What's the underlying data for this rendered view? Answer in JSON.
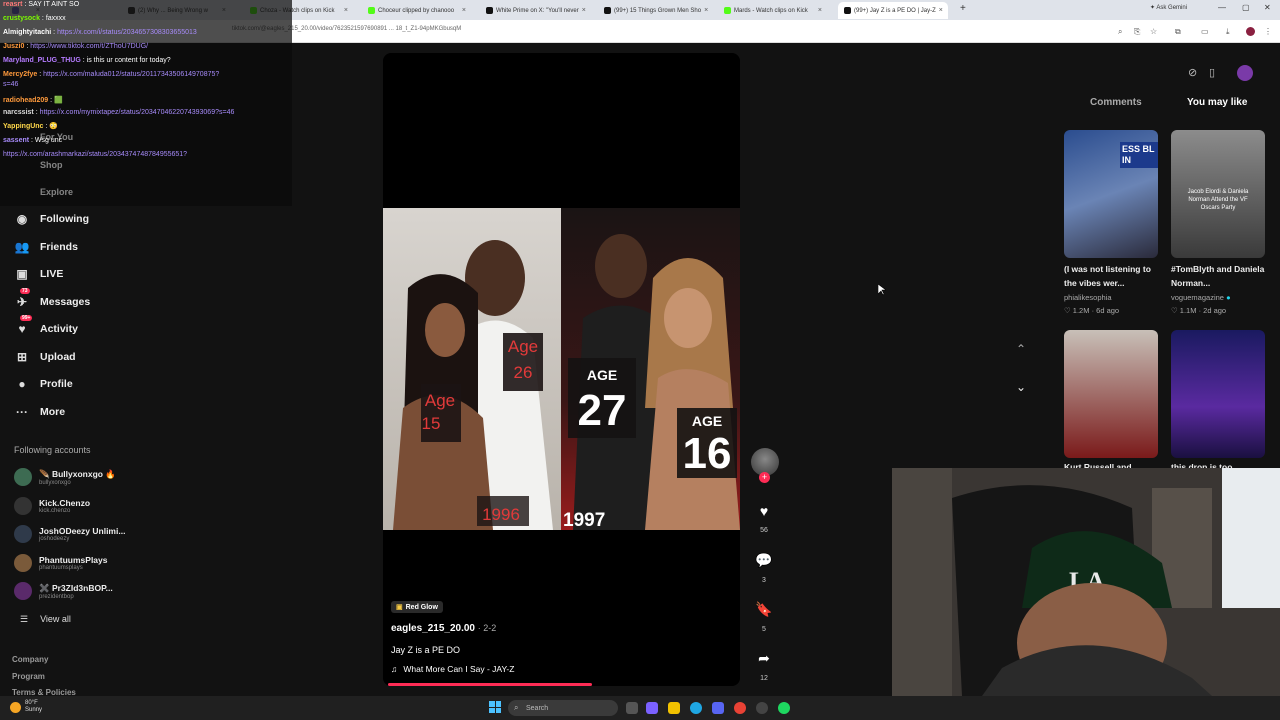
{
  "browser": {
    "tabs": [
      {
        "label": "",
        "color": "#6e6ec9"
      },
      {
        "label": "(2) Why ... Being Wrong w",
        "color": "#333"
      },
      {
        "label": "Choza - Watch clips on Kick",
        "color": "#53fc18"
      },
      {
        "label": "Choceur clipped by chanooo",
        "color": "#53fc18"
      },
      {
        "label": "White Prime on X: \"You'll never",
        "color": "#111"
      },
      {
        "label": "(99+) 15 Things Grown Men Sho",
        "color": "#111"
      },
      {
        "label": "Mards - Watch clips on Kick",
        "color": "#53fc18"
      },
      {
        "label": "(99+) Jay Z is a PE DO | Jay-Z",
        "color": "#111"
      }
    ],
    "new_tab": "+",
    "ask_gemini": "✦ Ask Gemini",
    "window_controls": [
      "—",
      "▢",
      "✕"
    ],
    "url": "tiktok.com/@eagles_215_20.00/video/7623521597690891 ... 18_t_Z1-94pMKGbusqM"
  },
  "chat": {
    "messages": [
      {
        "user": "reasrt",
        "text": "SAY IT AINT SO",
        "color": "#ff7a7a",
        "link": false
      },
      {
        "user": "crustysock",
        "text": "faxxxx",
        "color": "#7cfc00",
        "link": false
      },
      {
        "user": "Almightyitachi",
        "text": "https://x.com/i/status/2034657308303655013",
        "color": "#ffffff",
        "link": true
      },
      {
        "user": "Juszi0",
        "text": "https://www.tiktok.com/t/ZThoU7DUG/",
        "color": "#ff9a3c",
        "link": true
      },
      {
        "user": "Maryland_PLUG_THUG",
        "text": "is this ur content for today?",
        "color": "#b57bff",
        "link": false
      },
      {
        "user": "Mercy2fye",
        "text": "https://x.com/maluda012/status/2011734350614970875?",
        "color": "#ff9a3c",
        "link": true
      },
      {
        "user": "",
        "text": "s=46",
        "color": "#ffffff",
        "link": true
      },
      {
        "user": "radiohead209",
        "text": "🟩",
        "color": "#ff9a3c",
        "link": false
      },
      {
        "user": "narcssist",
        "text": "https://x.com/mymixtapez/status/2034704622074393069?s=46",
        "color": "#dddddd",
        "link": true
      },
      {
        "user": "YappingUnc",
        "text": "😳",
        "color": "#ffd84a",
        "link": false
      },
      {
        "user": "sassent",
        "text": "Wsg unc",
        "color": "#a78bfa",
        "link": false
      },
      {
        "user": "",
        "text": "https://x.com/arashmarkazi/status/2034374748784955651?",
        "color": "#a78bfa",
        "link": true
      }
    ],
    "ghost_nav": [
      "For You",
      "Shop",
      "Explore"
    ]
  },
  "sidebar": {
    "nav": [
      {
        "label": "Following",
        "icon": "following-icon",
        "glyph": "◉",
        "badge": ""
      },
      {
        "label": "Friends",
        "icon": "friends-icon",
        "glyph": "👥",
        "badge": ""
      },
      {
        "label": "LIVE",
        "icon": "live-icon",
        "glyph": "▣",
        "badge": ""
      },
      {
        "label": "Messages",
        "icon": "messages-icon",
        "glyph": "✈",
        "badge": "73"
      },
      {
        "label": "Activity",
        "icon": "activity-icon",
        "glyph": "♥",
        "badge": "99+"
      },
      {
        "label": "Upload",
        "icon": "upload-icon",
        "glyph": "⊞",
        "badge": ""
      },
      {
        "label": "Profile",
        "icon": "profile-icon",
        "glyph": "●",
        "badge": ""
      },
      {
        "label": "More",
        "icon": "more-icon",
        "glyph": "···",
        "badge": ""
      }
    ],
    "following_title": "Following accounts",
    "accounts": [
      {
        "name": "🪶 Bullyxonxgo 🔥",
        "handle": "bullyxonxgo"
      },
      {
        "name": "Kick.Chenzo",
        "handle": "kick.chenzo"
      },
      {
        "name": "JoshODeezy Unlimi...",
        "handle": "joshodeezy"
      },
      {
        "name": "PhantuumsPlays",
        "handle": "phantuumsplays"
      },
      {
        "name": "✖️ Pr3ZId3nBOP...",
        "handle": "prezidentbop"
      }
    ],
    "view_all": "View all",
    "footer": [
      "Company",
      "Program",
      "Terms & Policies"
    ]
  },
  "video": {
    "labels": {
      "age15": "Age\n15",
      "age26": "Age\n26",
      "year1996": "1996",
      "age27_label": "AGE",
      "age27": "27",
      "age16_label": "AGE",
      "age16": "16",
      "year1997": "1997"
    },
    "tag": "Red Glow",
    "author": "eagles_215_20.00",
    "date": "· 2-2",
    "caption": "Jay Z is a PE DO",
    "music": "What More Can I Say - JAY-Z",
    "progress": 0.58,
    "likes": "56",
    "comments": "3",
    "saves": "5",
    "shares": "12"
  },
  "right_panel": {
    "tab_comments": "Comments",
    "tab_you_may_like": "You may like",
    "items": [
      {
        "title": "(I was not listening to the vibes wer...",
        "author": "phialikesophia",
        "views": "♡ 1.2M",
        "age": "6d ago",
        "verified": false
      },
      {
        "title": "#TomBlyth and Daniela Norman...",
        "author": "voguemagazine",
        "views": "♡ 1.1M",
        "age": "2d ago",
        "verified": true
      },
      {
        "title": "Kurt Russell and",
        "author": "",
        "views": "",
        "age": "",
        "verified": false
      },
      {
        "title": "this drop is too",
        "author": "",
        "views": "",
        "age": "",
        "verified": false
      }
    ],
    "thumb_texts": [
      "ESS BL IN",
      "Jacob Elordi & Daniela Norman Attend the VF Oscars Party"
    ]
  },
  "taskbar": {
    "temp": "80°F",
    "weather": "Sunny",
    "search": "Search"
  },
  "colors": {
    "accent": "#fe2c55",
    "bg": "#121212",
    "link": "#a78bfa"
  }
}
